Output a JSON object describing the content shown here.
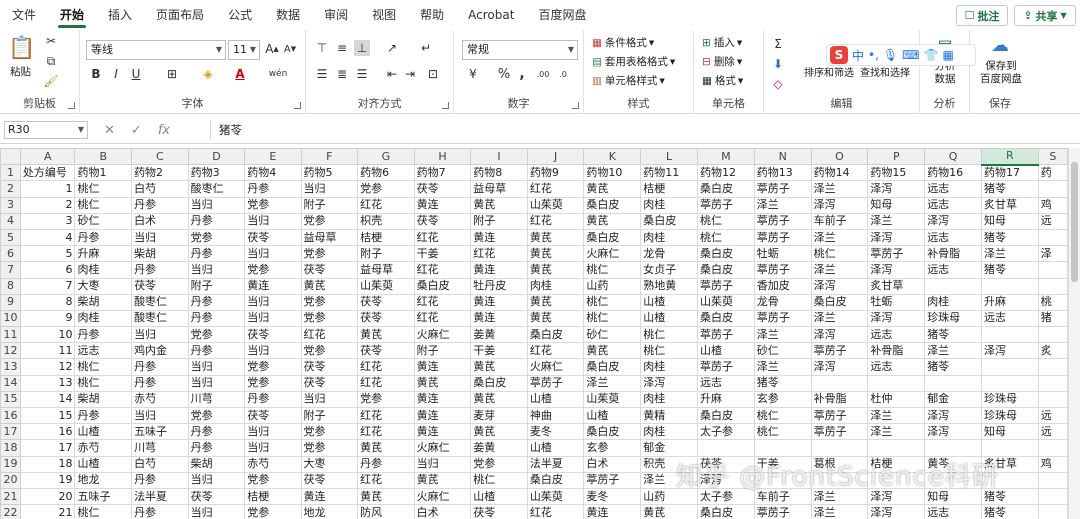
{
  "menu": {
    "tabs": [
      "文件",
      "开始",
      "插入",
      "页面布局",
      "公式",
      "数据",
      "审阅",
      "视图",
      "帮助",
      "Acrobat",
      "百度网盘"
    ],
    "active_tab": "开始",
    "comment": "批注",
    "share": "共享"
  },
  "ribbon": {
    "clipboard": {
      "paste": "粘贴",
      "label": "剪贴板"
    },
    "font": {
      "name": "等线",
      "size": "11",
      "label": "字体"
    },
    "alignment": {
      "label": "对齐方式"
    },
    "number": {
      "format": "常规",
      "label": "数字"
    },
    "styles": {
      "conditional": "条件格式",
      "table": "套用表格格式",
      "cell_styles": "单元格样式",
      "label": "样式"
    },
    "cells": {
      "insert": "插入",
      "delete": "删除",
      "format": "格式",
      "label": "单元格"
    },
    "editing": {
      "sort": "排序和筛选",
      "find": "查找和选择",
      "label": "编辑"
    },
    "analysis": {
      "analyze": "分析\n数据",
      "label": "分析"
    },
    "save": {
      "baidu": "保存到\n百度网盘",
      "label": "保存"
    }
  },
  "formula_bar": {
    "name_box": "R30",
    "value": "猪苓"
  },
  "sheet": {
    "columns": [
      "A",
      "B",
      "C",
      "D",
      "E",
      "F",
      "G",
      "H",
      "I",
      "J",
      "K",
      "L",
      "M",
      "N",
      "O",
      "P",
      "Q",
      "R",
      "S"
    ],
    "selected_column": "R",
    "rows": [
      [
        "处方编号",
        "药物1",
        "药物2",
        "药物3",
        "药物4",
        "药物5",
        "药物6",
        "药物7",
        "药物8",
        "药物9",
        "药物10",
        "药物11",
        "药物12",
        "药物13",
        "药物14",
        "药物15",
        "药物16",
        "药物17",
        "药"
      ],
      [
        "1",
        "桃仁",
        "白芍",
        "酸枣仁",
        "丹参",
        "当归",
        "党参",
        "茯苓",
        "益母草",
        "红花",
        "黄芪",
        "桔梗",
        "桑白皮",
        "葶苈子",
        "泽兰",
        "泽泻",
        "远志",
        "猪苓",
        ""
      ],
      [
        "2",
        "桃仁",
        "丹参",
        "当归",
        "党参",
        "附子",
        "红花",
        "黄连",
        "黄芪",
        "山茱萸",
        "桑白皮",
        "肉桂",
        "葶苈子",
        "泽兰",
        "泽泻",
        "知母",
        "远志",
        "炙甘草",
        "鸡"
      ],
      [
        "3",
        "砂仁",
        "白术",
        "丹参",
        "当归",
        "党参",
        "枳壳",
        "茯苓",
        "附子",
        "红花",
        "黄芪",
        "桑白皮",
        "桃仁",
        "葶苈子",
        "车前子",
        "泽兰",
        "泽泻",
        "知母",
        "远"
      ],
      [
        "4",
        "丹参",
        "当归",
        "党参",
        "茯苓",
        "益母草",
        "桔梗",
        "红花",
        "黄连",
        "黄芪",
        "桑白皮",
        "肉桂",
        "桃仁",
        "葶苈子",
        "泽兰",
        "泽泻",
        "远志",
        "猪苓",
        ""
      ],
      [
        "5",
        "升麻",
        "柴胡",
        "丹参",
        "当归",
        "党参",
        "附子",
        "干姜",
        "红花",
        "黄芪",
        "火麻仁",
        "龙骨",
        "桑白皮",
        "牡蛎",
        "桃仁",
        "葶苈子",
        "补骨脂",
        "泽兰",
        "泽"
      ],
      [
        "6",
        "肉桂",
        "丹参",
        "当归",
        "党参",
        "茯苓",
        "益母草",
        "红花",
        "黄连",
        "黄芪",
        "桃仁",
        "女贞子",
        "桑白皮",
        "葶苈子",
        "泽兰",
        "泽泻",
        "远志",
        "猪苓",
        ""
      ],
      [
        "7",
        "大枣",
        "茯苓",
        "附子",
        "黄连",
        "黄芪",
        "山茱萸",
        "桑白皮",
        "牡丹皮",
        "肉桂",
        "山药",
        "熟地黄",
        "葶苈子",
        "香加皮",
        "泽泻",
        "炙甘草",
        "",
        "",
        " "
      ],
      [
        "8",
        "柴胡",
        "酸枣仁",
        "丹参",
        "当归",
        "党参",
        "茯苓",
        "红花",
        "黄连",
        "黄芪",
        "桃仁",
        "山楂",
        "山茱萸",
        "龙骨",
        "桑白皮",
        "牡蛎",
        "肉桂",
        "升麻",
        "桃"
      ],
      [
        "9",
        "肉桂",
        "酸枣仁",
        "丹参",
        "当归",
        "党参",
        "茯苓",
        "红花",
        "黄连",
        "黄芪",
        "桃仁",
        "山楂",
        "桑白皮",
        "葶苈子",
        "泽兰",
        "泽泻",
        "珍珠母",
        "远志",
        "猪"
      ],
      [
        "10",
        "丹参",
        "当归",
        "党参",
        "茯苓",
        "红花",
        "黄芪",
        "火麻仁",
        "姜黄",
        "桑白皮",
        "砂仁",
        "桃仁",
        "葶苈子",
        "泽兰",
        "泽泻",
        "远志",
        "猪苓",
        "",
        ""
      ],
      [
        "11",
        "远志",
        "鸡内金",
        "丹参",
        "当归",
        "党参",
        "茯苓",
        "附子",
        "干姜",
        "红花",
        "黄芪",
        "桃仁",
        "山楂",
        "砂仁",
        "葶苈子",
        "补骨脂",
        "泽兰",
        "泽泻",
        "炙"
      ],
      [
        "12",
        "桃仁",
        "丹参",
        "当归",
        "党参",
        "茯苓",
        "红花",
        "黄连",
        "黄芪",
        "火麻仁",
        "桑白皮",
        "肉桂",
        "葶苈子",
        "泽兰",
        "泽泻",
        "远志",
        "猪苓",
        "",
        ""
      ],
      [
        "13",
        "桃仁",
        "丹参",
        "当归",
        "党参",
        "茯苓",
        "红花",
        "黄芪",
        "桑白皮",
        "葶苈子",
        "泽兰",
        "泽泻",
        "远志",
        "猪苓",
        "",
        "",
        "",
        "",
        ""
      ],
      [
        "14",
        "柴胡",
        "赤芍",
        "川芎",
        "丹参",
        "当归",
        "党参",
        "黄连",
        "黄芪",
        "山楂",
        "山茱萸",
        "肉桂",
        "升麻",
        "玄参",
        "补骨脂",
        "杜仲",
        "郁金",
        "珍珠母",
        ""
      ],
      [
        "15",
        "丹参",
        "当归",
        "党参",
        "茯苓",
        "附子",
        "红花",
        "黄连",
        "麦芽",
        "神曲",
        "山楂",
        "黄精",
        "桑白皮",
        "桃仁",
        "葶苈子",
        "泽兰",
        "泽泻",
        "珍珠母",
        "远"
      ],
      [
        "16",
        "山楂",
        "五味子",
        "丹参",
        "当归",
        "党参",
        "红花",
        "黄连",
        "黄芪",
        "麦冬",
        "桑白皮",
        "肉桂",
        "太子参",
        "桃仁",
        "葶苈子",
        "泽兰",
        "泽泻",
        "知母",
        "远"
      ],
      [
        "17",
        "赤芍",
        "川芎",
        "丹参",
        "当归",
        "党参",
        "黄芪",
        "火麻仁",
        "姜黄",
        "山楂",
        "玄参",
        "郁金",
        "",
        "",
        "",
        "",
        "",
        "",
        ""
      ],
      [
        "18",
        "山楂",
        "白芍",
        "柴胡",
        "赤芍",
        "大枣",
        "丹参",
        "当归",
        "党参",
        "法半夏",
        "白术",
        "积壳",
        "茯苓",
        "干姜",
        "葛根",
        "桔梗",
        "黄芩",
        "炙甘草",
        "鸡"
      ],
      [
        "19",
        "地龙",
        "丹参",
        "当归",
        "党参",
        "茯苓",
        "红花",
        "黄芪",
        "桃仁",
        "桑白皮",
        "葶苈子",
        "泽兰",
        "泽泻",
        "",
        "",
        "",
        "",
        "",
        ""
      ],
      [
        "20",
        "五味子",
        "法半夏",
        "茯苓",
        "桔梗",
        "黄连",
        "黄芪",
        "火麻仁",
        "山楂",
        "山茱萸",
        "麦冬",
        "山药",
        "太子参",
        "车前子",
        "泽兰",
        "泽泻",
        "知母",
        "猪苓",
        ""
      ],
      [
        "21",
        "桃仁",
        "丹参",
        "当归",
        "党参",
        "地龙",
        "防风",
        "白术",
        "茯苓",
        "红花",
        "黄连",
        "黄芪",
        "桑白皮",
        "葶苈子",
        "泽兰",
        "泽泻",
        "远志",
        "猪苓",
        ""
      ],
      [
        "22",
        "当归",
        "白芍",
        "赤芍",
        "川芎",
        "丹参",
        "党参",
        "法半夏",
        "合欢皮",
        "红花",
        "黄芪",
        "肉桂",
        "牛膝",
        "",
        "",
        "",
        "",
        "",
        ""
      ]
    ]
  },
  "watermark": "知乎 @FrontScience科研",
  "colors": {
    "accent": "#217346",
    "selected_header": "#d3e9dc"
  }
}
